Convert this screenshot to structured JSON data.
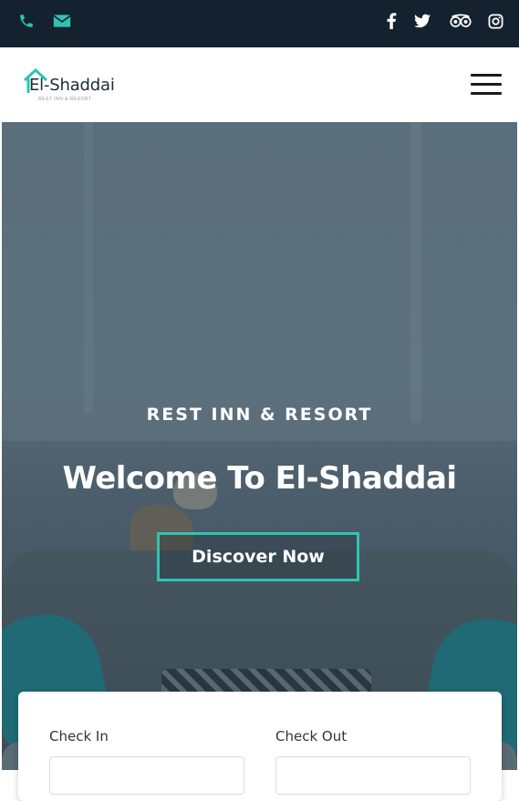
{
  "topbar": {
    "contact_icons": [
      "phone-icon",
      "envelope-icon"
    ],
    "social_icons": [
      "facebook-icon",
      "twitter-icon",
      "tripadvisor-icon",
      "instagram-icon"
    ],
    "accent_color": "#2fc4b2",
    "background_color": "#13222e"
  },
  "header": {
    "logo_text": "El-Shaddai",
    "logo_tagline": "REST INN & RESORT",
    "menu_icon": "hamburger-icon"
  },
  "hero": {
    "subtitle": "REST INN & RESORT",
    "title": "Welcome To El-Shaddai",
    "cta_label": "Discover Now"
  },
  "booking": {
    "check_in_label": "Check In",
    "check_out_label": "Check Out"
  }
}
